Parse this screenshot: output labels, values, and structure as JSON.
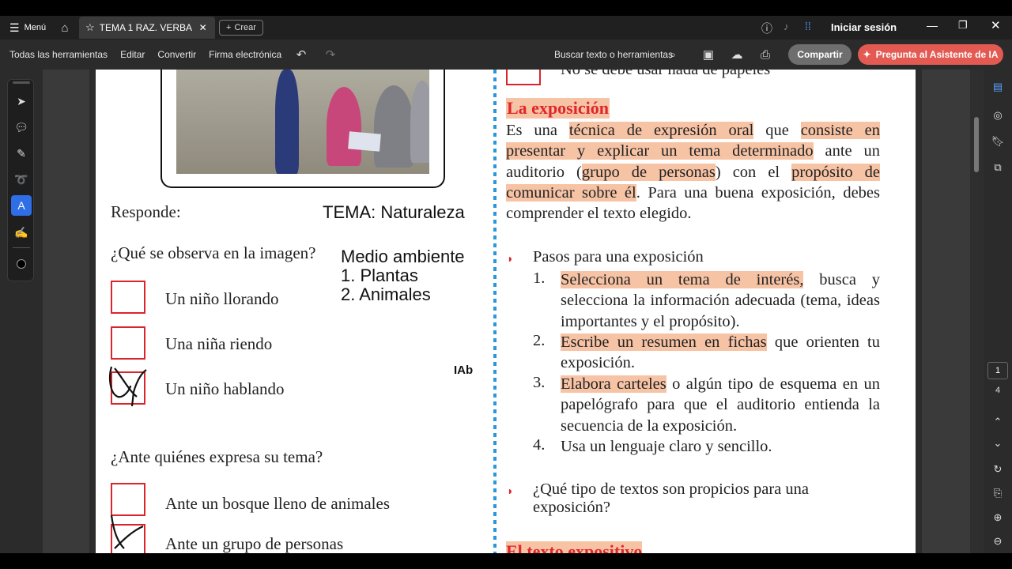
{
  "topbar": {
    "menu_label": "Menú",
    "tab_title": "TEMA 1 RAZ. VERBA...",
    "create_label": "Crear",
    "signin_label": "Iniciar sesión"
  },
  "toolbar": {
    "all_tools": "Todas las herramientas",
    "edit": "Editar",
    "convert": "Convertir",
    "esign": "Firma electrónica",
    "search": "Buscar texto o herramientas",
    "share": "Compartir",
    "ai": "Pregunta al Asistente de IA"
  },
  "page_nav": {
    "current": "1",
    "total": "4"
  },
  "left_col": {
    "responde": "Responde:",
    "q1": "¿Qué se observa en la imagen?",
    "q1_options": [
      "Un niño llorando",
      "Una niña riendo",
      "Un niño hablando"
    ],
    "q2": "¿Ante quiénes expresa su tema?",
    "q2_options": [
      "Ante un bosque lleno de animales",
      "Ante un grupo de personas"
    ],
    "typed_topic": "TEMA: Naturaleza",
    "typed_lines": [
      "Medio ambiente",
      "1. Plantas",
      "2. Animales"
    ],
    "text_cursor": "IAb"
  },
  "right_col": {
    "top_cut_text": "No se debe usar nada de papeles",
    "heading": "La exposición",
    "para_parts": {
      "p1": "Es una ",
      "h1": "técnica de expresión oral",
      "p2": " que ",
      "h2": "consiste en presentar y explicar un tema determinado",
      "p3": " ante un auditorio (",
      "h3": "grupo de personas",
      "p4": ") con el ",
      "h4": "propósito de comunicar sobre él",
      "p5": ". Para una buena exposición, debes comprender el texto elegido."
    },
    "steps_title": "Pasos para una exposición",
    "step1_hl": "Selecciona un tema de interés,",
    "step1_rest": " busca y selecciona la información adecuada (tema, ideas importantes y el propósito).",
    "step2_hl": "Escribe un resumen en fichas",
    "step2_rest": " que orienten tu exposición.",
    "step3_hl": "Elabora carteles",
    "step3_rest": " o algún tipo de esquema en un papelógrafo para que el auditorio entienda la secuencia de la exposición.",
    "step4": "Usa un lenguaje claro y sencillo.",
    "nums": [
      "1.",
      "2.",
      "3.",
      "4."
    ],
    "q_texts": "¿Qué tipo de textos son propicios para una exposición?",
    "bottom_cut_heading": "El texto expositivo"
  },
  "colors": {
    "accent_red": "#d9252b",
    "highlight": "#f7c3a5",
    "divider_blue": "#2a98d8",
    "ai_button": "#e35a52"
  }
}
